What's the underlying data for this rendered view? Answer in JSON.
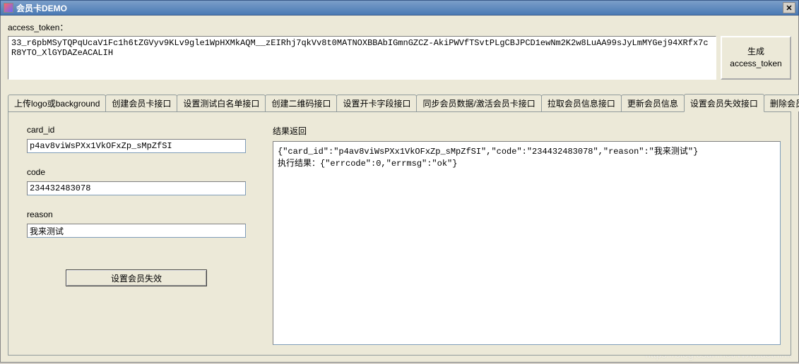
{
  "window": {
    "title": "会员卡DEMO",
    "close_symbol": "✕"
  },
  "token": {
    "label": "access_token：",
    "value": "33_r6pbMSyTQPqUcaV1Fc1h6tZGVyv9KLv9gle1WpHXMkAQM__zEIRhj7qkVv8t0MATNOXBBAbIGmnGZCZ-AkiPWVfTSvtPLgCBJPCD1ewNm2K2w8LuAA99sJyLmMYGej94XRfx7cR8YTO_XlGYDAZeACALIH",
    "generate_btn": "生成\naccess_token"
  },
  "tabs": [
    {
      "label": "上传logo或background"
    },
    {
      "label": "创建会员卡接口"
    },
    {
      "label": "设置测试白名单接口"
    },
    {
      "label": "创建二维码接口"
    },
    {
      "label": "设置开卡字段接口"
    },
    {
      "label": "同步会员数据/激活会员卡接口"
    },
    {
      "label": "拉取会员信息接口"
    },
    {
      "label": "更新会员信息"
    },
    {
      "label": "设置会员失效接口"
    },
    {
      "label": "删除会员卡"
    }
  ],
  "form": {
    "card_id_label": "card_id",
    "card_id_value": "p4av8viWsPXx1VkOFxZp_sMpZfSI",
    "code_label": "code",
    "code_value": "234432483078",
    "reason_label": "reason",
    "reason_value": "我来测试",
    "submit_btn": "设置会员失效"
  },
  "result": {
    "label": "结果返回",
    "text": "{\"card_id\":\"p4av8viWsPXx1VkOFxZp_sMpZfSI\",\"code\":\"234432483078\",\"reason\":\"我来测试\"}\n执行结果：{\"errcode\":0,\"errmsg\":\"ok\"}"
  },
  "watermark": "https://blog.csdn.net/WXbluethink"
}
